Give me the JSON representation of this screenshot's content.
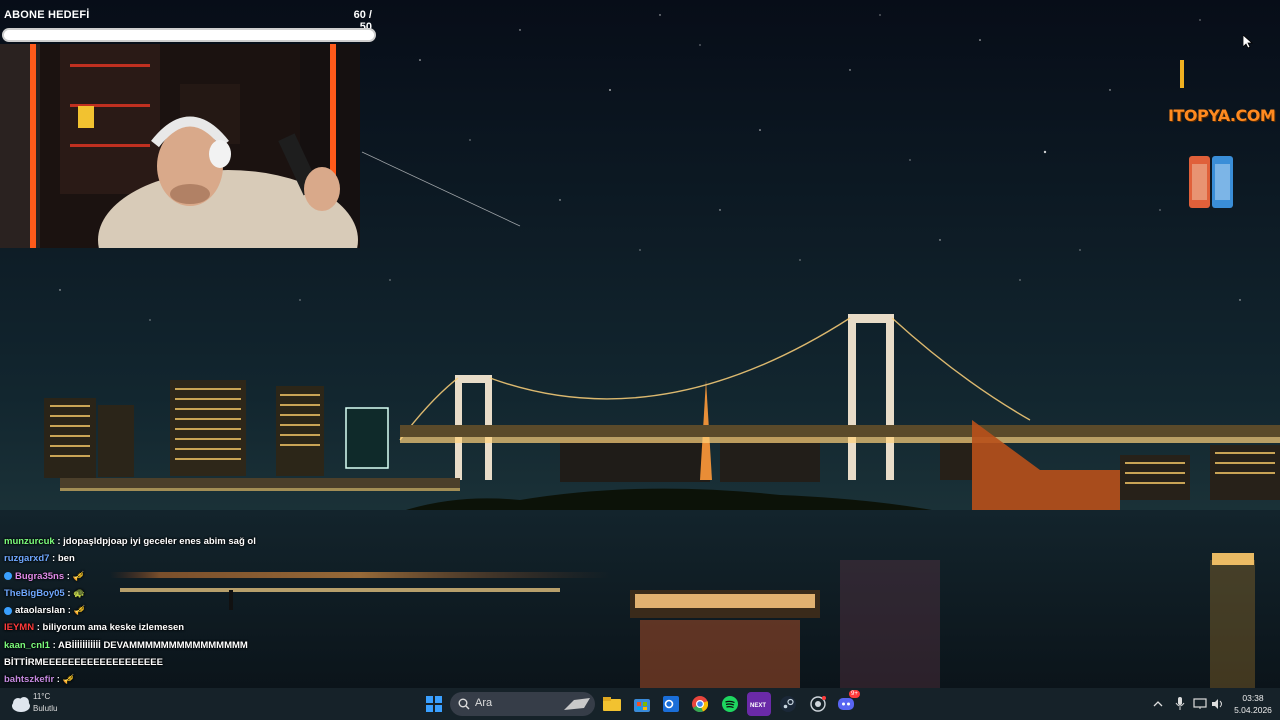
{
  "sub_goal": {
    "title": "ABONE HEDEFİ",
    "count": "60 / 50",
    "progress": 1.0
  },
  "chat": {
    "messages": [
      {
        "user": "munzurcuk",
        "color": "#7CFC7C",
        "badge": "",
        "text": "jdopaşldpjoap iyi geceler enes abim sağ ol"
      },
      {
        "user": "ruzgarxd7",
        "color": "#6fa8ff",
        "badge": "",
        "text": "ben"
      },
      {
        "user": "Bugra35ns",
        "color": "#e08ae8",
        "badge": "badge-icon",
        "text": "🎺"
      },
      {
        "user": "TheBigBoy05",
        "color": "#6fa8ff",
        "badge": "",
        "text": "🐢"
      },
      {
        "user": "ataolarslan",
        "color": "#ffffff",
        "badge": "badge-icon",
        "text": "🎺"
      },
      {
        "user": "IEYMN",
        "color": "#ff3b3b",
        "badge": "",
        "text": "biliyorum ama keske izlemesen"
      },
      {
        "user": "kaan_cnl1",
        "color": "#7CFC7C",
        "badge": "",
        "text": "ABİİİİİİİİİİİ DEVAMMMMMMMMMMMMMMM"
      },
      {
        "user": "",
        "color": "#ffffff",
        "badge": "",
        "text": "BİTTİRMEEEEEEEEEEEEEEEEEEE"
      },
      {
        "user": "bahtszkefir",
        "color": "#c48ae0",
        "badge": "",
        "text": "🎺"
      }
    ]
  },
  "overlay": {
    "sponsor_logo": "ITOPYA.COM"
  },
  "taskbar": {
    "weather_temp": "11°C",
    "weather_label": "Bulutlu",
    "search_placeholder": "Ara",
    "time": "03:38",
    "date": "5.04.2026",
    "discord_badge": "9+"
  },
  "colors": {
    "sky_top": "#0a1220",
    "sky_bottom": "#1c3340",
    "water": "#0e1a22",
    "bridge_lights": "#ffd27a",
    "accent_orange": "#ff6a1a"
  }
}
